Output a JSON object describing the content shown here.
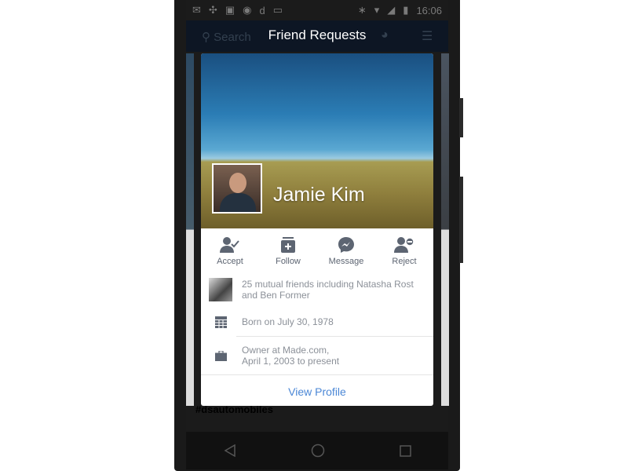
{
  "status_bar": {
    "time": "16:06"
  },
  "app_bar": {
    "title": "Friend Requests",
    "search_placeholder": "Search"
  },
  "background": {
    "hashtag": "#dsautomobiles"
  },
  "card": {
    "name": "Jamie Kim",
    "actions": [
      {
        "label": "Accept",
        "icon": "accept-friend-icon"
      },
      {
        "label": "Follow",
        "icon": "follow-icon"
      },
      {
        "label": "Message",
        "icon": "messenger-icon"
      },
      {
        "label": "Reject",
        "icon": "reject-friend-icon"
      }
    ],
    "mutual_line1": "25 mutual friends including Natasha Rost",
    "mutual_line2": "and Ben Former",
    "born": "Born on July 30, 1978",
    "work_line1": "Owner at Made.com,",
    "work_line2": "April 1, 2003 to present",
    "view_profile": "View Profile"
  },
  "colors": {
    "accent": "#4b87d6",
    "icon": "#5d6572",
    "appbar": "#0d1624"
  }
}
